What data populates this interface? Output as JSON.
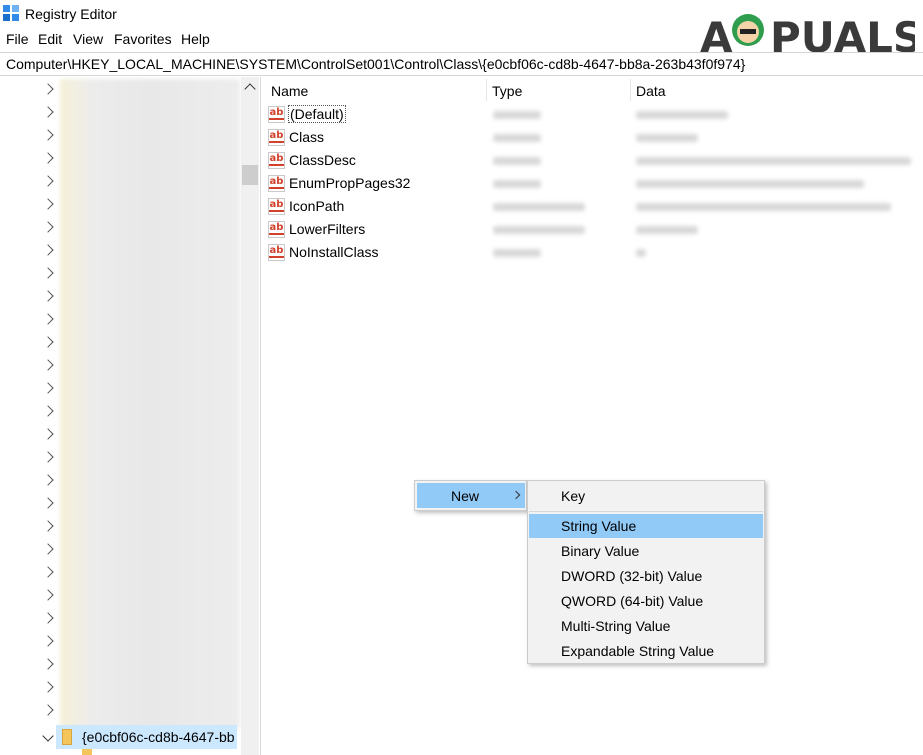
{
  "window": {
    "title": "Registry Editor"
  },
  "watermark": {
    "text": "APPUALS"
  },
  "menu": [
    "File",
    "Edit",
    "View",
    "Favorites",
    "Help"
  ],
  "address": "Computer\\HKEY_LOCAL_MACHINE\\SYSTEM\\ControlSet001\\Control\\Class\\{e0cbf06c-cd8b-4647-bb8a-263b43f0f974}",
  "tree": {
    "selected_label": "{e0cbf06c-cd8b-4647-bb"
  },
  "columns": {
    "name": "Name",
    "type": "Type",
    "data": "Data"
  },
  "values": [
    {
      "name": "(Default)"
    },
    {
      "name": "Class"
    },
    {
      "name": "ClassDesc"
    },
    {
      "name": "EnumPropPages32"
    },
    {
      "name": "IconPath"
    },
    {
      "name": "LowerFilters"
    },
    {
      "name": "NoInstallClass"
    }
  ],
  "context_menu": {
    "new_label": "New"
  },
  "submenu": [
    "Key",
    "String Value",
    "Binary Value",
    "DWORD (32-bit) Value",
    "QWORD (64-bit) Value",
    "Multi-String Value",
    "Expandable String Value"
  ],
  "colors": {
    "highlight": "#91c9f7",
    "tree_selection": "#cce8ff",
    "string_icon": "#d2412b"
  },
  "icons": {
    "app": "registry-editor-icon",
    "value": "string-value-icon",
    "folder": "folder-icon"
  }
}
